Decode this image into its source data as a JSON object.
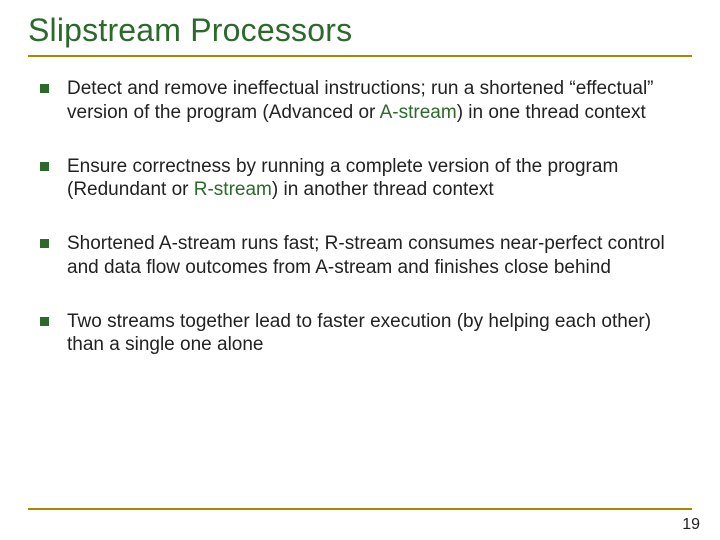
{
  "title": "Slipstream Processors",
  "bullets": [
    {
      "pre": "Detect and remove ineffectual instructions; run a shortened “effectual” version of the program (Advanced or ",
      "hi": "A-stream",
      "post": ") in one thread context"
    },
    {
      "pre": "Ensure correctness by running a complete version of the program (Redundant or ",
      "hi": "R-stream",
      "post": ") in another thread context"
    },
    {
      "pre": "Shortened A-stream runs fast; R-stream consumes near-perfect control and data flow outcomes from A-stream and finishes close behind",
      "hi": "",
      "post": ""
    },
    {
      "pre": "Two streams together lead to faster execution (by helping each other) than a single one alone",
      "hi": "",
      "post": ""
    }
  ],
  "page_number": "19"
}
